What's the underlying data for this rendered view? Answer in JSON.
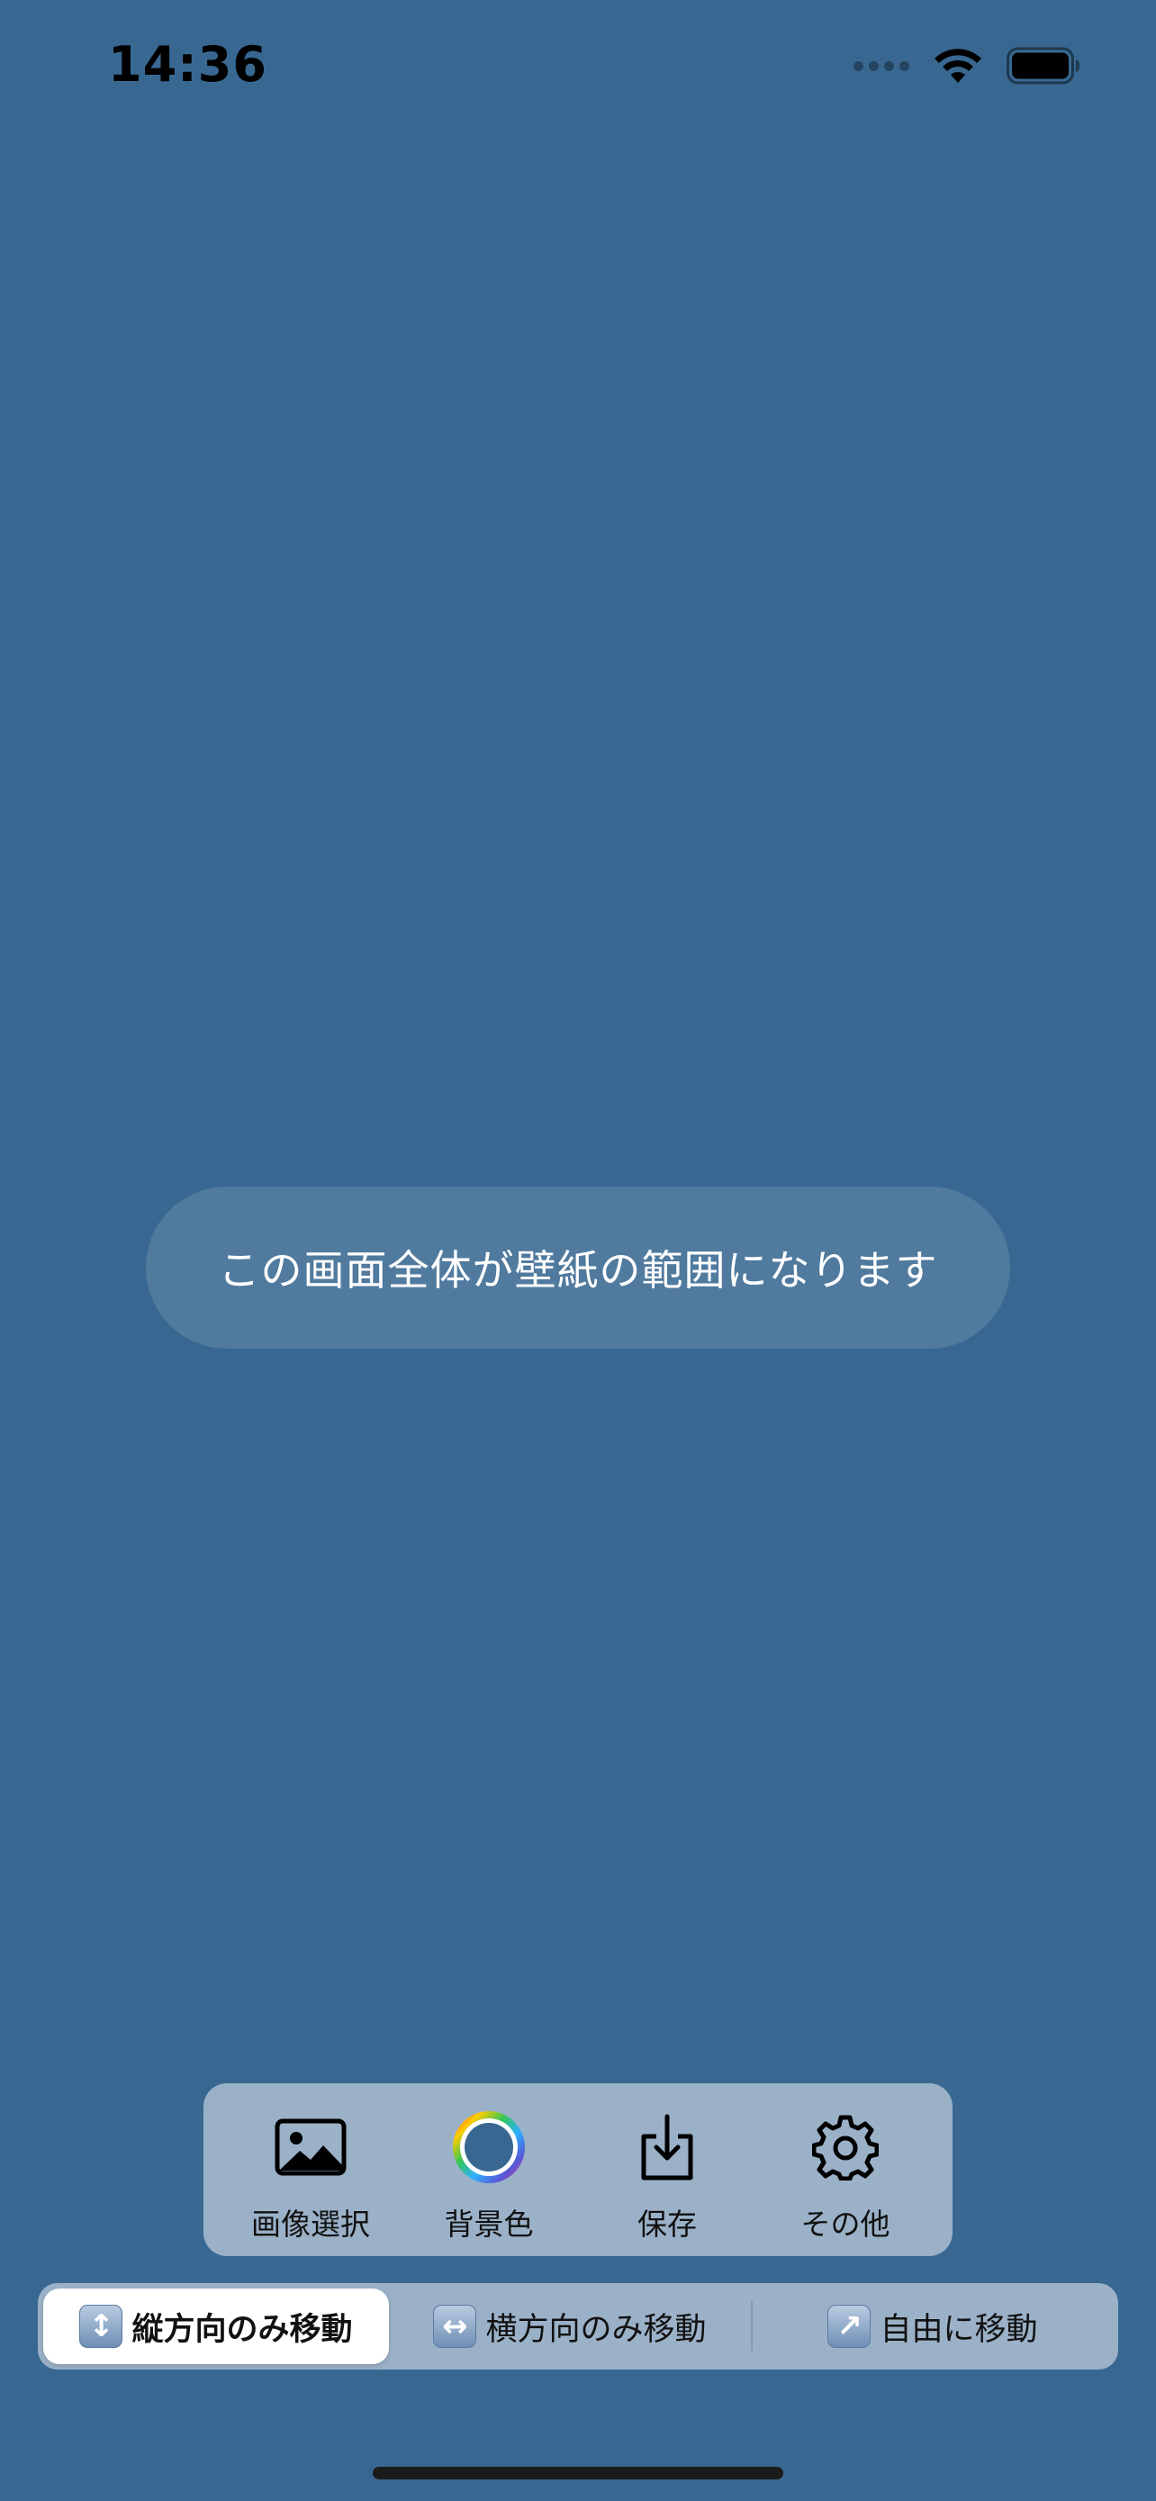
{
  "status_bar": {
    "time": "14:36",
    "icons": [
      "cellular-signal-icon",
      "wifi-icon",
      "battery-icon"
    ]
  },
  "center_message": "この画面全体が壁紙の範囲になります",
  "toolbar": {
    "items": [
      {
        "label": "画像選択",
        "icon": "photo-icon"
      },
      {
        "label": "背景色",
        "icon": "color-wheel-icon"
      },
      {
        "label": "保存",
        "icon": "download-icon"
      },
      {
        "label": "その他",
        "icon": "gear-icon"
      }
    ]
  },
  "movement_mode": {
    "options": [
      {
        "label": "縦方向のみ移動",
        "icon": "up-down-arrow-icon",
        "glyph": "↕",
        "selected": true
      },
      {
        "label": "横方向のみ移動",
        "icon": "left-right-arrow-icon",
        "glyph": "↔",
        "selected": false
      },
      {
        "label": "自由に移動",
        "icon": "up-right-arrow-icon",
        "glyph": "↗",
        "selected": false
      }
    ]
  },
  "colors": {
    "background": "#386891",
    "toolbar_bg": "#9bb1c8",
    "selected_segment": "#ffffff"
  }
}
